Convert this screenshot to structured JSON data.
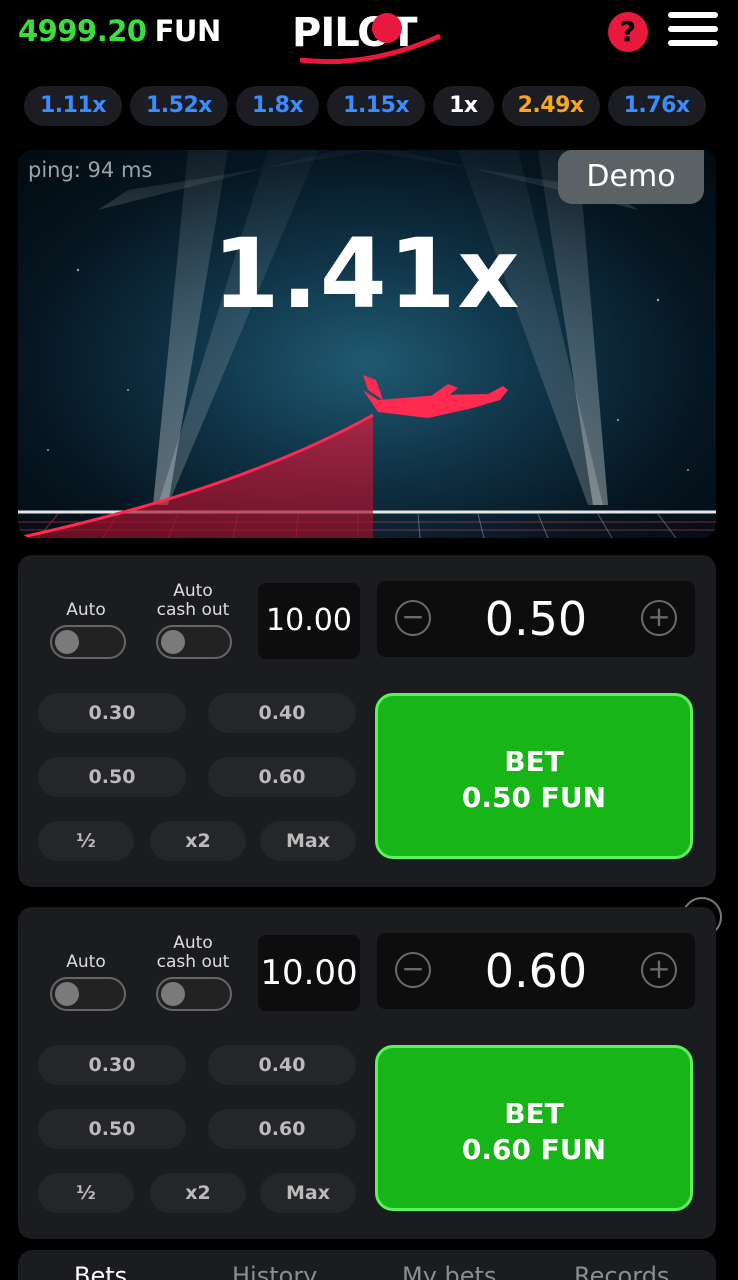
{
  "header": {
    "balance_amount": "4999.20",
    "balance_currency": "FUN",
    "logo_text": "PILOT",
    "help_label": "?"
  },
  "multiplier_history": [
    {
      "label": "1.11x",
      "color": "blue"
    },
    {
      "label": "1.52x",
      "color": "blue"
    },
    {
      "label": "1.8x",
      "color": "blue"
    },
    {
      "label": "1.15x",
      "color": "blue"
    },
    {
      "label": "1x",
      "color": "white"
    },
    {
      "label": "2.49x",
      "color": "orange"
    },
    {
      "label": "1.76x",
      "color": "blue"
    }
  ],
  "game": {
    "ping_text": "ping: 94 ms",
    "demo_label": "Demo",
    "current_multiplier": "1.41x"
  },
  "bet_panels": [
    {
      "auto_label": "Auto",
      "auto_cashout_label_1": "Auto",
      "auto_cashout_label_2": "cash out",
      "auto_on": false,
      "auto_cashout_on": false,
      "cashout_value": "10.00",
      "stake_value": "0.50",
      "quick_amounts": [
        "0.30",
        "0.40",
        "0.50",
        "0.60"
      ],
      "half_label": "½",
      "double_label": "x2",
      "max_label": "Max",
      "bet_label": "BET",
      "bet_amount_label": "0.50 FUN"
    },
    {
      "auto_label": "Auto",
      "auto_cashout_label_1": "Auto",
      "auto_cashout_label_2": "cash out",
      "auto_on": false,
      "auto_cashout_on": false,
      "cashout_value": "10.00",
      "stake_value": "0.60",
      "quick_amounts": [
        "0.30",
        "0.40",
        "0.50",
        "0.60"
      ],
      "half_label": "½",
      "double_label": "x2",
      "max_label": "Max",
      "bet_label": "BET",
      "bet_amount_label": "0.60 FUN"
    }
  ],
  "tabs": [
    {
      "label": "Bets",
      "active": true
    },
    {
      "label": "History",
      "active": false
    },
    {
      "label": "My bets",
      "active": false
    },
    {
      "label": "Records",
      "active": false
    }
  ],
  "icons": {
    "minus": "−",
    "plus": "+",
    "remove_panel": "−"
  },
  "colors": {
    "balance": "#3ddc3d",
    "accent_red": "#e8193c",
    "bet_green": "#17b517",
    "mult_blue": "#3b8dff",
    "mult_orange": "#f5a623"
  }
}
